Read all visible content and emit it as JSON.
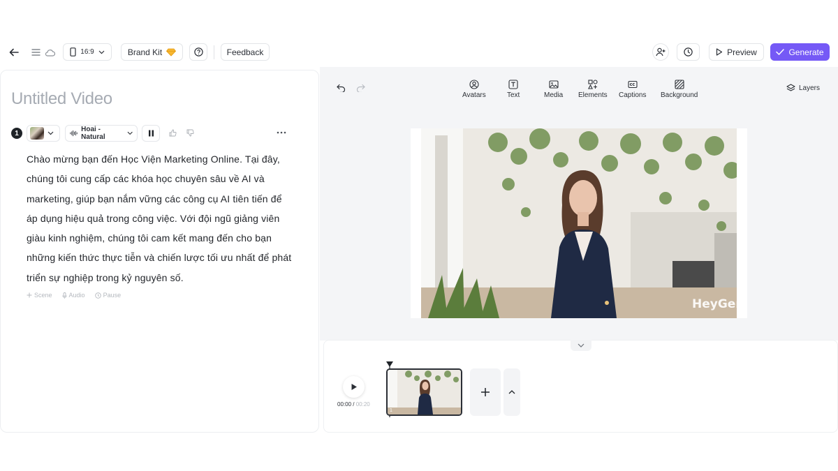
{
  "toolbar": {
    "aspect_ratio": "16:9",
    "brand_kit_label": "Brand Kit",
    "feedback_label": "Feedback",
    "preview_label": "Preview",
    "generate_label": "Generate"
  },
  "editor": {
    "title": "Untitled Video",
    "scene_number": "1",
    "voice_label": "Hoai - Natural",
    "script_text": "Chào mừng bạn đến Học Viện Marketing Online. Tại đây, chúng tôi cung cấp các khóa học chuyên sâu về AI và marketing, giúp bạn nắm vững các công cụ AI tiên tiến để áp dụng hiệu quả trong công việc. Với đội ngũ giảng viên giàu kinh nghiệm, chúng tôi cam kết mang đến cho bạn những kiến thức thực tiễn và chiến lược tối ưu nhất để phát triển sự nghiệp trong kỷ nguyên số.",
    "actions": {
      "scene": "Scene",
      "audio": "Audio",
      "pause": "Pause"
    }
  },
  "canvas": {
    "tools": [
      {
        "label": "Avatars",
        "icon": "avatar-icon"
      },
      {
        "label": "Text",
        "icon": "text-icon"
      },
      {
        "label": "Media",
        "icon": "image-icon"
      },
      {
        "label": "Elements",
        "icon": "elements-icon"
      },
      {
        "label": "Captions",
        "icon": "captions-icon"
      },
      {
        "label": "Background",
        "icon": "background-icon"
      }
    ],
    "layers_label": "Layers",
    "watermark": "HeyGen"
  },
  "timeline": {
    "current_time": "00:00",
    "total_time": "00:20",
    "clip_index": "1"
  },
  "colors": {
    "accent": "#7559f6",
    "canvas_bg": "#f4f5f7",
    "title_muted": "#a6abb3"
  }
}
